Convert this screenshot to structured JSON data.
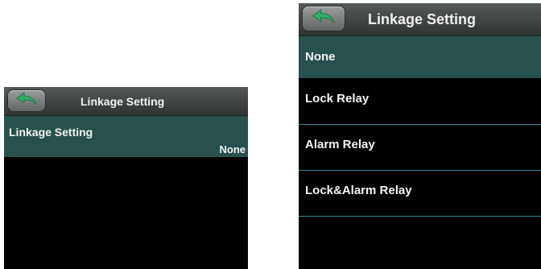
{
  "left_screen": {
    "header": {
      "title": "Linkage Setting",
      "back_icon": "back-arrow-icon"
    },
    "setting_row": {
      "label": "Linkage Setting",
      "value": "None"
    }
  },
  "right_screen": {
    "header": {
      "title": "Linkage Setting",
      "back_icon": "back-arrow-icon"
    },
    "options": [
      {
        "label": "None",
        "selected": true
      },
      {
        "label": "Lock Relay",
        "selected": false
      },
      {
        "label": "Alarm Relay",
        "selected": false
      },
      {
        "label": "Lock&Alarm Relay",
        "selected": false
      }
    ]
  },
  "colors": {
    "screen_bg": "#000000",
    "selected_row": "#28514d",
    "divider": "#2d8a9a",
    "back_arrow": "#2fae6a",
    "text": "#f4f4f4"
  }
}
